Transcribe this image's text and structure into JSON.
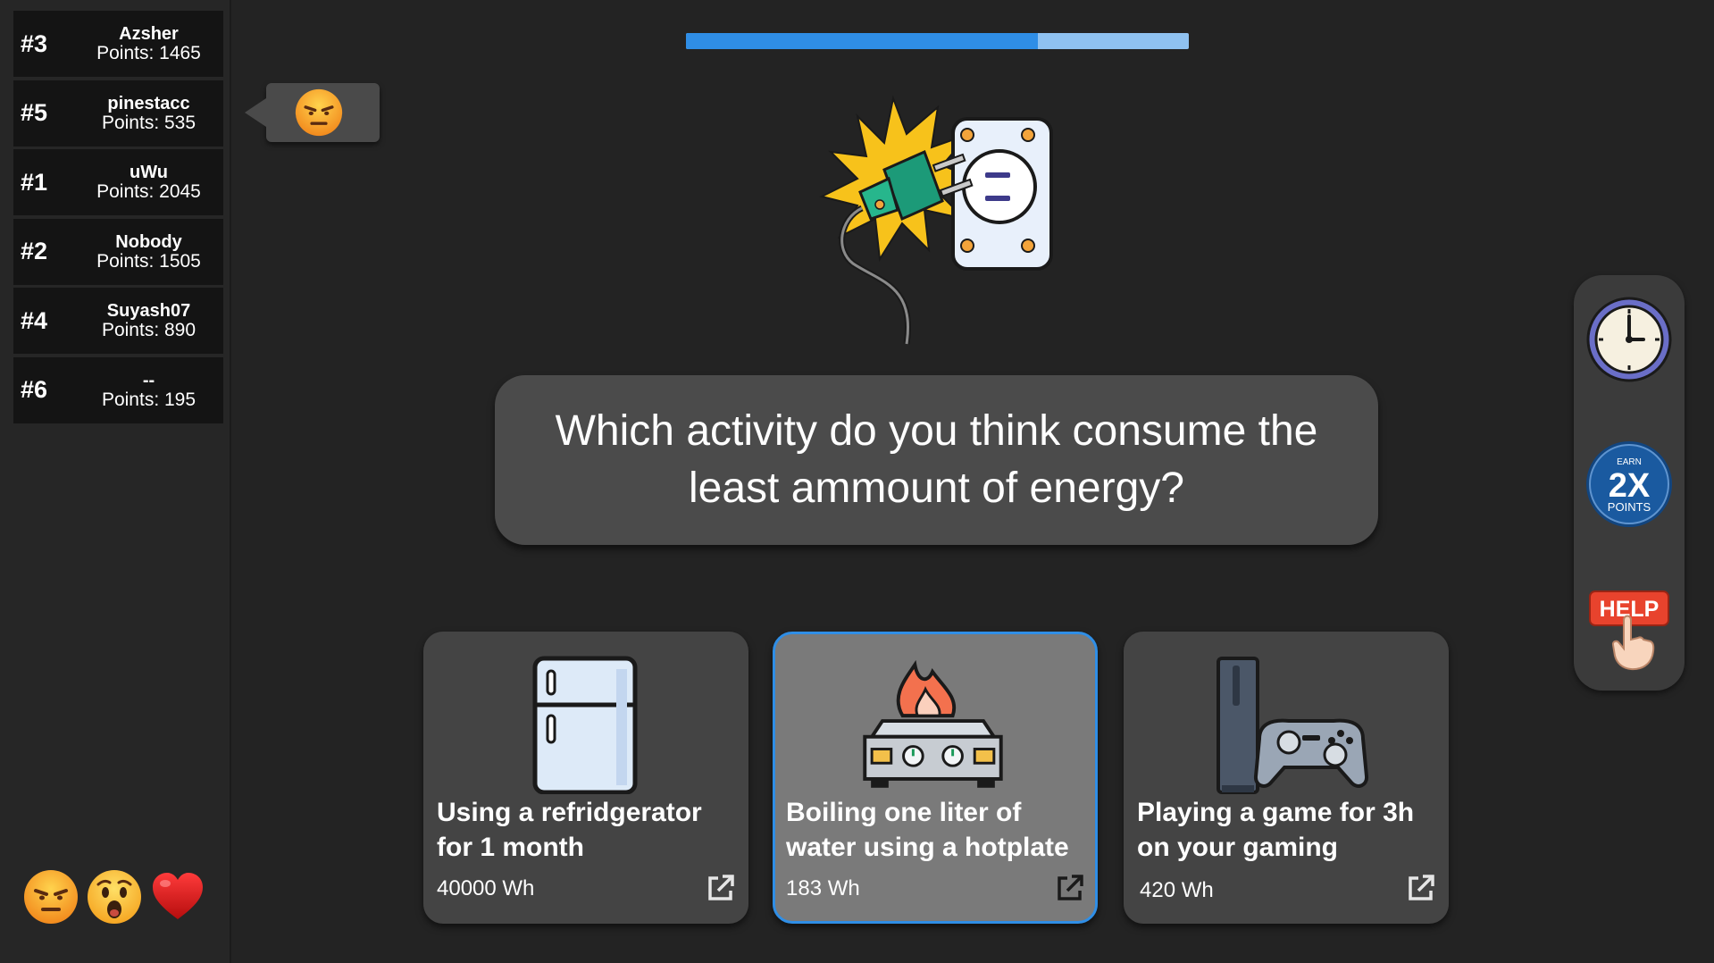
{
  "leaderboard": [
    {
      "rank": "#3",
      "name": "Azsher",
      "points": "Points: 1465"
    },
    {
      "rank": "#5",
      "name": "pinestacc",
      "points": "Points: 535"
    },
    {
      "rank": "#1",
      "name": "uWu",
      "points": "Points: 2045"
    },
    {
      "rank": "#2",
      "name": "Nobody",
      "points": "Points: 1505"
    },
    {
      "rank": "#4",
      "name": "Suyash07",
      "points": "Points: 890"
    },
    {
      "rank": "#6",
      "name": "--",
      "points": "Points: 195"
    }
  ],
  "reaction_bubble": {
    "icon": "angry-face-icon"
  },
  "progress": {
    "fraction": 0.7
  },
  "question": {
    "image_icon": "plug-socket-icon",
    "text": "Which activity do you think consume the least ammount of energy?"
  },
  "answers": [
    {
      "icon": "refrigerator-icon",
      "title": "Using a refridgerator for 1 month",
      "value": "40000 Wh",
      "selected": false
    },
    {
      "icon": "hotplate-fire-icon",
      "title": "Boiling one liter of water using a hotplate",
      "value": "183 Wh",
      "selected": true
    },
    {
      "icon": "console-gamepad-icon",
      "title": "Playing a game for 3h on your gaming",
      "value": "420 Wh",
      "selected": false
    }
  ],
  "powerups": {
    "clock_icon": "clock-icon",
    "double_points": {
      "top": "EARN",
      "big": "2X",
      "bottom": "POINTS"
    },
    "help": {
      "label": "HELP"
    }
  },
  "reactions": [
    "angry-face-icon",
    "surprised-face-icon",
    "heart-icon"
  ],
  "colors": {
    "accent": "#2f8ee6",
    "progress_track": "#8fc1f0",
    "help_red": "#e8432d",
    "badge_blue": "#1a5aa0"
  }
}
